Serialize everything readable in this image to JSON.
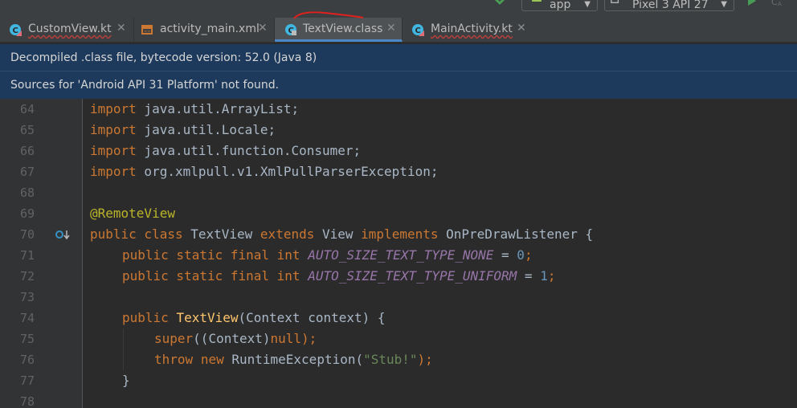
{
  "toolbar": {
    "run_config": "app",
    "device": "Pixel 3 API 27"
  },
  "tabs": [
    {
      "label": "CustomView.kt",
      "icon": "kotlin-class-icon",
      "active": false
    },
    {
      "label": "activity_main.xml",
      "icon": "xml-layout-icon",
      "active": false
    },
    {
      "label": "TextView.class",
      "icon": "class-file-icon",
      "active": true
    },
    {
      "label": "MainActivity.kt",
      "icon": "kotlin-class-icon",
      "active": false
    }
  ],
  "banners": {
    "decompiled": "Decompiled .class file, bytecode version: 52.0 (Java 8)",
    "sources": "Sources for 'Android API 31 Platform' not found."
  },
  "editor": {
    "line_numbers": [
      "64",
      "65",
      "66",
      "67",
      "68",
      "69",
      "70",
      "71",
      "72",
      "73",
      "74",
      "75",
      "76",
      "77",
      "78"
    ],
    "lines": {
      "l64": {
        "kw": "import",
        "rest": " java.util.ArrayList;"
      },
      "l65": {
        "kw": "import",
        "rest": " java.util.Locale;"
      },
      "l66": {
        "kw": "import",
        "rest": " java.util.function.Consumer;"
      },
      "l67": {
        "kw": "import",
        "rest": " org.xmlpull.v1.XmlPullParserException;"
      },
      "l69": {
        "annotation": "@RemoteView"
      },
      "l70": {
        "kw1": "public class",
        "name": " TextView ",
        "kw2": "extends",
        "parent": " View ",
        "kw3": "implements",
        "iface": " OnPreDrawListener {"
      },
      "l71": {
        "kw": "public static final int",
        "const": "AUTO_SIZE_TEXT_TYPE_NONE",
        "eq": " = ",
        "value": "0",
        "end": ";"
      },
      "l72": {
        "kw": "public static final int",
        "const": "AUTO_SIZE_TEXT_TYPE_UNIFORM",
        "eq": " = ",
        "value": "1",
        "end": ";"
      },
      "l74": {
        "kw": "public",
        "fn": "TextView",
        "params": "(Context context) {"
      },
      "l75": {
        "kw": "super",
        "open": "((Context)",
        "null": "null",
        "close": ");"
      },
      "l76": {
        "kw1": "throw",
        "kw2": "new",
        "call": " RuntimeException(",
        "str": "\"Stub!\"",
        "close": ");"
      },
      "l77": {
        "brace": "}"
      }
    }
  },
  "colors": {
    "keyword": "#cc7832",
    "annotation": "#bbb529",
    "string": "#6a8759",
    "number": "#6897bb",
    "constant": "#9876aa",
    "method": "#ffc66d",
    "banner": "#1d3a5c",
    "active_tab_underline": "#4a88c7"
  }
}
